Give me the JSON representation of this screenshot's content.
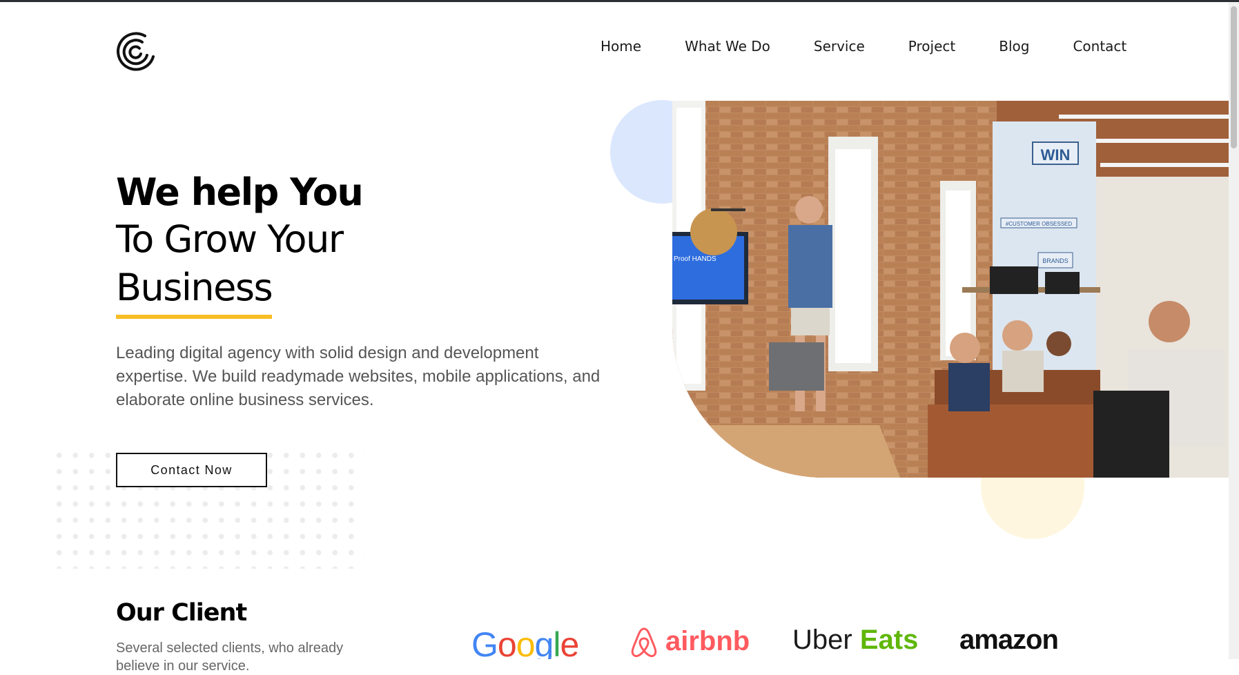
{
  "nav": {
    "items": [
      {
        "label": "Home"
      },
      {
        "label": "What We Do"
      },
      {
        "label": "Service"
      },
      {
        "label": "Project"
      },
      {
        "label": "Blog"
      },
      {
        "label": "Contact"
      }
    ]
  },
  "hero": {
    "title_line1": "We help You",
    "title_line2": "To Grow Your",
    "title_line3": "Business",
    "description": "Leading digital agency with solid design and development expertise. We build readymade websites, mobile applications, and elaborate online business services.",
    "cta_label": "Contact Now",
    "image_texts": {
      "win": "WIN",
      "customer_obsessed": "#CUSTOMER OBSESSED",
      "brands": "BRANDS",
      "screen": "Proof HANDS"
    }
  },
  "clients": {
    "title": "Our Client",
    "description": "Several selected clients, who already believe in our service.",
    "logos": {
      "google": [
        "G",
        "o",
        "o",
        "g",
        "l",
        "e"
      ],
      "airbnb": "airbnb",
      "ubereats_uber": "Uber",
      "ubereats_eats": "Eats",
      "amazon": "amazon"
    }
  },
  "colors": {
    "accent_yellow": "#f7be25",
    "blue_shape": "#dbe7fd",
    "yellow_shape": "#fef6de"
  },
  "icons": {
    "logo": "spiral-logo-icon"
  }
}
